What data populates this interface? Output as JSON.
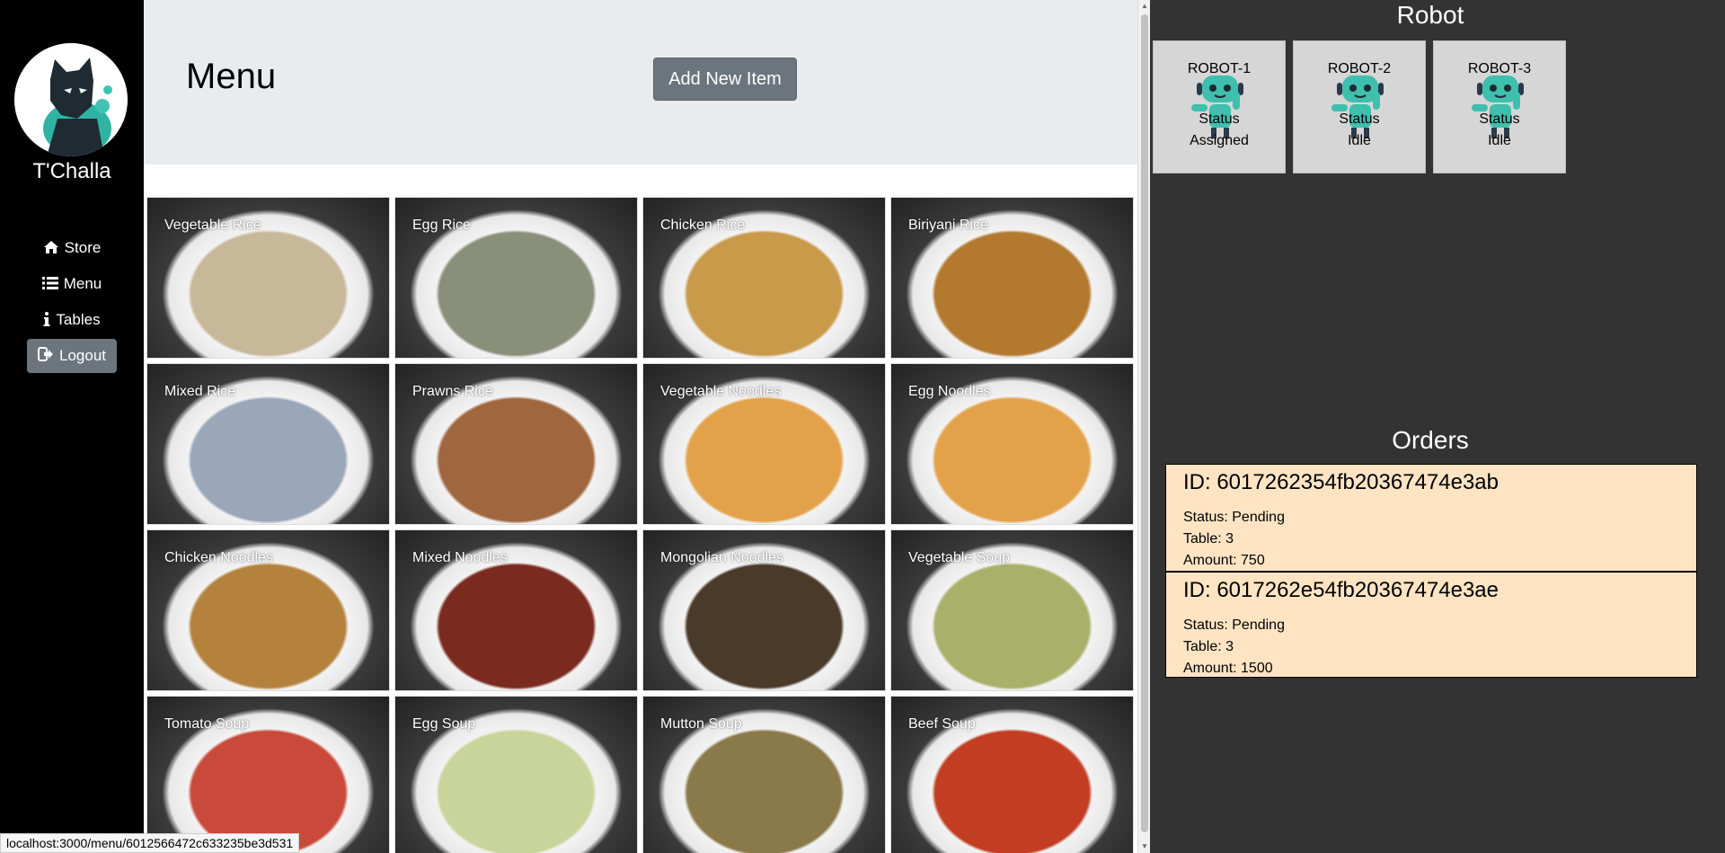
{
  "sidebar": {
    "username": "T'Challa",
    "nav": [
      {
        "label": "Store",
        "icon": "home-icon"
      },
      {
        "label": "Menu",
        "icon": "list-icon"
      },
      {
        "label": "Tables",
        "icon": "info-icon"
      }
    ],
    "logout_label": "Logout"
  },
  "main": {
    "title": "Menu",
    "add_button": "Add New Item",
    "items": [
      {
        "name": "Vegetable Rice",
        "color": "#c8b89a"
      },
      {
        "name": "Egg Rice",
        "color": "#8a8f7a"
      },
      {
        "name": "Chicken Rice",
        "color": "#c99a4a"
      },
      {
        "name": "Biriyani Rice",
        "color": "#b37a2f"
      },
      {
        "name": "Mixed Rice",
        "color": "#9aa7b8"
      },
      {
        "name": "Prawns Rice",
        "color": "#a0663e"
      },
      {
        "name": "Vegetable Noodles",
        "color": "#e3a24a"
      },
      {
        "name": "Egg Noodles",
        "color": "#e3a24a"
      },
      {
        "name": "Chicken Noodles",
        "color": "#b5823e"
      },
      {
        "name": "Mixed Noodles",
        "color": "#7a2a1f"
      },
      {
        "name": "Mongolian Noodles",
        "color": "#4a3a2a"
      },
      {
        "name": "Vegetable Soup",
        "color": "#a9b06a"
      },
      {
        "name": "Tomato Soup",
        "color": "#c9493a"
      },
      {
        "name": "Egg Soup",
        "color": "#c9d49a"
      },
      {
        "name": "Mutton Soup",
        "color": "#8a7a4a"
      },
      {
        "name": "Beef Soup",
        "color": "#c23d22"
      }
    ]
  },
  "robots": {
    "heading": "Robot",
    "status_label": "Status",
    "list": [
      {
        "name": "ROBOT-1",
        "status": "Assigned"
      },
      {
        "name": "ROBOT-2",
        "status": "Idle"
      },
      {
        "name": "ROBOT-3",
        "status": "Idle"
      }
    ]
  },
  "orders": {
    "heading": "Orders",
    "list": [
      {
        "id": "ID: 6017262354fb20367474e3ab",
        "status": "Status: Pending",
        "table": "Table: 3",
        "amount": "Amount: 750"
      },
      {
        "id": "ID: 6017262e54fb20367474e3ae",
        "status": "Status: Pending",
        "table": "Table: 3",
        "amount": "Amount: 1500"
      }
    ]
  },
  "statusbar": {
    "url": "localhost:3000/menu/6012566472c633235be3d531"
  },
  "colors": {
    "sidebar_bg": "#000000",
    "jumbotron_bg": "#e9ecef",
    "button_bg": "#6c757d",
    "right_panel_bg": "#333333",
    "robot_card_bg": "#d6d6d6",
    "order_bg": "#ffe4c4",
    "robot_teal": "#3fbfad"
  }
}
